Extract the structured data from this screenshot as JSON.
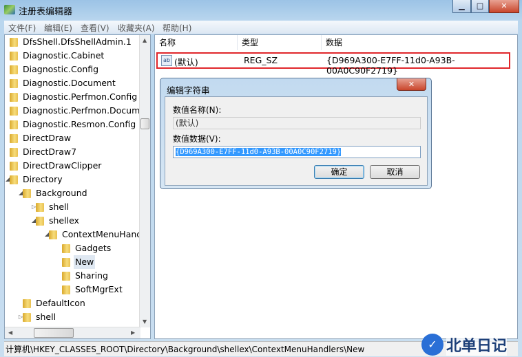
{
  "window": {
    "title": "注册表编辑器",
    "minimize": "▁",
    "maximize": "□",
    "close": "✕"
  },
  "menu": [
    "文件(F)",
    "编辑(E)",
    "查看(V)",
    "收藏夹(A)",
    "帮助(H)"
  ],
  "tree": [
    {
      "label": "DfsShell.DfsShellAdmin.1",
      "level": 0
    },
    {
      "label": "Diagnostic.Cabinet",
      "level": 0
    },
    {
      "label": "Diagnostic.Config",
      "level": 0
    },
    {
      "label": "Diagnostic.Document",
      "level": 0
    },
    {
      "label": "Diagnostic.Perfmon.Config",
      "level": 0
    },
    {
      "label": "Diagnostic.Perfmon.Document",
      "level": 0
    },
    {
      "label": "Diagnostic.Resmon.Config",
      "level": 0
    },
    {
      "label": "DirectDraw",
      "level": 0
    },
    {
      "label": "DirectDraw7",
      "level": 0
    },
    {
      "label": "DirectDrawClipper",
      "level": 0
    },
    {
      "label": "Directory",
      "level": 0,
      "expander": "expanded"
    },
    {
      "label": "Background",
      "level": 1,
      "expander": "expanded"
    },
    {
      "label": "shell",
      "level": 2,
      "expander": "collapsed"
    },
    {
      "label": "shellex",
      "level": 2,
      "expander": "expanded"
    },
    {
      "label": "ContextMenuHandlers",
      "level": 3,
      "expander": "expanded"
    },
    {
      "label": "Gadgets",
      "level": 4
    },
    {
      "label": "New",
      "level": 4,
      "selected": true
    },
    {
      "label": "Sharing",
      "level": 4
    },
    {
      "label": "SoftMgrExt",
      "level": 4
    },
    {
      "label": "DefaultIcon",
      "level": 1
    },
    {
      "label": "shell",
      "level": 1,
      "expander": "collapsed"
    }
  ],
  "list": {
    "columns": [
      "名称",
      "类型",
      "数据"
    ],
    "rows": [
      {
        "name": "(默认)",
        "type": "REG_SZ",
        "data": "{D969A300-E7FF-11d0-A93B-00A0C90F2719}",
        "icon": "ab-string-icon"
      }
    ]
  },
  "dialog": {
    "title": "编辑字符串",
    "name_label": "数值名称(N):",
    "name_value": "(默认)",
    "data_label": "数值数据(V):",
    "data_value": "{D969A300-E7FF-11d0-A93B-00A0C90F2719}",
    "ok": "确定",
    "cancel": "取消",
    "close": "✕"
  },
  "status": "计算机\\HKEY_CLASSES_ROOT\\Directory\\Background\\shellex\\ContextMenuHandlers\\New",
  "watermark": {
    "logo": "✓",
    "text": "北单日记"
  },
  "colors": {
    "highlight_box": "#e0262a",
    "selection": "#3399ff"
  }
}
